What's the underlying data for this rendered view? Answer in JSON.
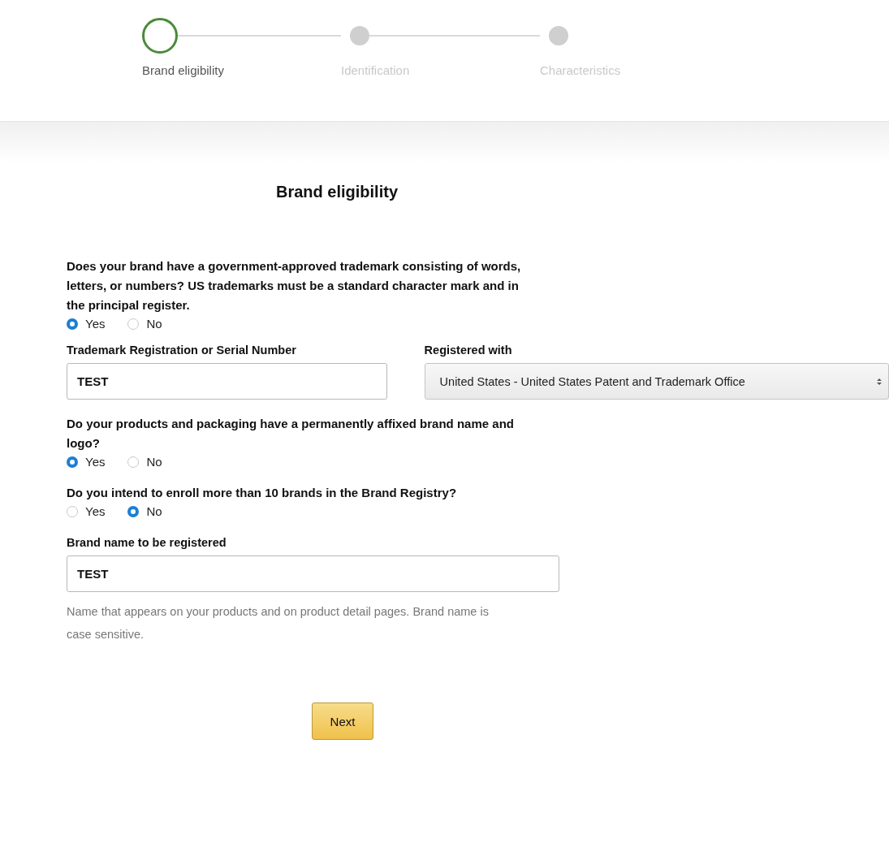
{
  "steps": [
    {
      "label": "Brand eligibility",
      "selected": true
    },
    {
      "label": "Identification",
      "selected": false
    },
    {
      "label": "Characteristics",
      "selected": false
    }
  ],
  "title": "Brand eligibility",
  "form": [
    {
      "kind": "radio",
      "question": "Does your brand have a government-approved trademark consisting of words, letters, or numbers? US trademarks must be a standard character mark and in the principal register.",
      "options": [
        {
          "label": "Yes",
          "selected": true
        },
        {
          "label": "No",
          "selected": false
        }
      ]
    },
    {
      "kind": "pair",
      "fields": [
        {
          "kind": "input",
          "label": "Trademark Registration or Serial Number",
          "value": "TEST"
        },
        {
          "kind": "select",
          "label": "Registered with",
          "value": "United States - United States Patent and Trademark Office"
        }
      ]
    },
    {
      "kind": "radio",
      "question": "Do your products and packaging have a permanently affixed brand name and logo?",
      "options": [
        {
          "label": "Yes",
          "selected": true
        },
        {
          "label": "No",
          "selected": false
        }
      ]
    },
    {
      "kind": "radio",
      "question": "Do you intend to enroll more than 10 brands in the Brand Registry?",
      "options": [
        {
          "label": "Yes",
          "selected": false
        },
        {
          "label": "No",
          "selected": true
        }
      ]
    },
    {
      "kind": "input",
      "label": "Brand name to be registered",
      "value": "TEST",
      "hint": "Name that appears on your products and on product detail pages. Brand name is case sensitive."
    }
  ],
  "next_button": "Next"
}
